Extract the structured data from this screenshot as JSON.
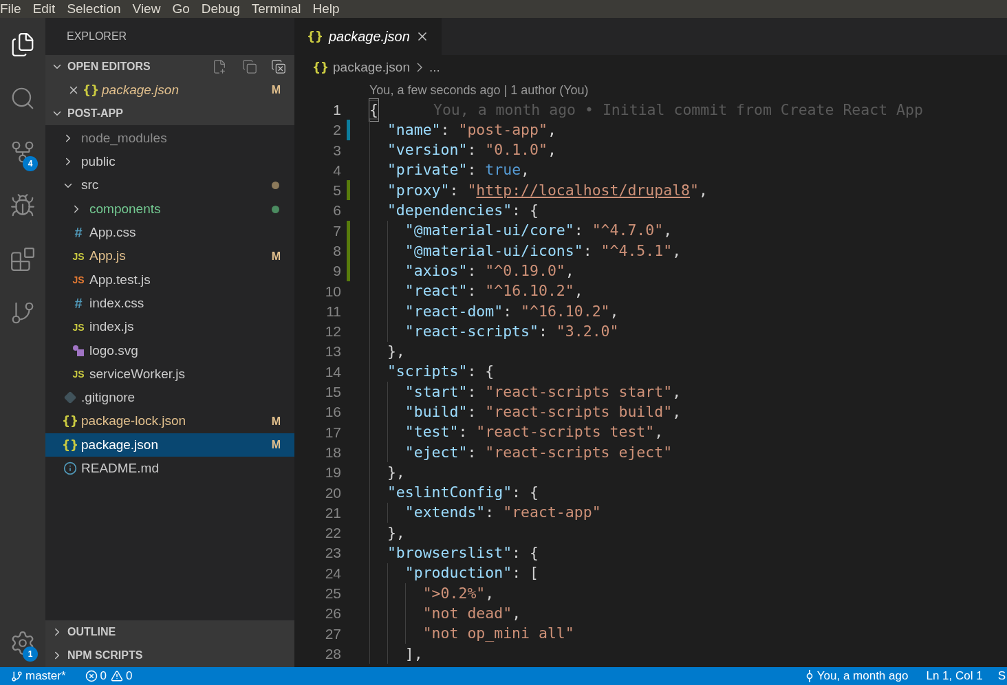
{
  "menu": [
    "File",
    "Edit",
    "Selection",
    "View",
    "Go",
    "Debug",
    "Terminal",
    "Help"
  ],
  "activity_bar": [
    {
      "kind": "files",
      "selected": true
    },
    {
      "kind": "search",
      "selected": false
    },
    {
      "kind": "source-control",
      "selected": false,
      "badge": "4"
    },
    {
      "kind": "debug",
      "selected": false
    },
    {
      "kind": "extensions",
      "selected": false
    },
    {
      "kind": "git-graph",
      "selected": false
    }
  ],
  "settings_badge": "1",
  "sidebar": {
    "title": "EXPLORER",
    "open_editors": {
      "title": "OPEN EDITORS",
      "expanded": true,
      "items": [
        {
          "name": "package.json",
          "kind": "json",
          "glyph": "{}",
          "italic": true,
          "color": "#e2c08d",
          "badge": {
            "text": "M",
            "color": "#e2c08d"
          }
        }
      ]
    },
    "folder": {
      "title": "POST-APP",
      "expanded": true,
      "items": [
        {
          "name": "node_modules",
          "kind": "folder",
          "expanded": false,
          "color": "#8c8c8c",
          "selected": false
        },
        {
          "name": "public",
          "kind": "folder",
          "expanded": false,
          "color": "#cccccc",
          "selected": false
        },
        {
          "name": "src",
          "kind": "folder",
          "expanded": true,
          "color": "#cccccc",
          "selected": false,
          "dot": {
            "color": "#8c7a5b"
          },
          "children": [
            {
              "name": "components",
              "kind": "folder",
              "expanded": false,
              "color": "#73c991",
              "selected": false,
              "dot": {
                "color": "#4b8b60"
              }
            },
            {
              "name": "App.css",
              "kind": "css",
              "glyph": "#",
              "color": "#cccccc",
              "selected": false
            },
            {
              "name": "App.js",
              "kind": "js",
              "glyph": "JS",
              "color": "#e2c08d",
              "selected": false,
              "badge": {
                "text": "M",
                "color": "#e2c08d"
              }
            },
            {
              "name": "App.test.js",
              "kind": "js-test",
              "glyph": "JS",
              "color": "#cccccc",
              "selected": false
            },
            {
              "name": "index.css",
              "kind": "css",
              "glyph": "#",
              "color": "#cccccc",
              "selected": false
            },
            {
              "name": "index.js",
              "kind": "js",
              "glyph": "JS",
              "color": "#cccccc",
              "selected": false
            },
            {
              "name": "logo.svg",
              "kind": "svg",
              "color": "#cccccc",
              "selected": false
            },
            {
              "name": "serviceWorker.js",
              "kind": "js",
              "glyph": "JS",
              "color": "#cccccc",
              "selected": false
            }
          ]
        },
        {
          "name": ".gitignore",
          "kind": "git",
          "color": "#cccccc",
          "selected": false
        },
        {
          "name": "package-lock.json",
          "kind": "json",
          "glyph": "{}",
          "color": "#e2c08d",
          "selected": false,
          "badge": {
            "text": "M",
            "color": "#e2c08d"
          }
        },
        {
          "name": "package.json",
          "kind": "json",
          "glyph": "{}",
          "color": "#ffffff",
          "selected": true,
          "badge": {
            "text": "M",
            "color": "#e2c08d"
          }
        },
        {
          "name": "README.md",
          "kind": "info",
          "color": "#cccccc",
          "selected": false
        }
      ]
    },
    "bottom_sections": [
      {
        "title": "OUTLINE",
        "expanded": false
      },
      {
        "title": "NPM SCRIPTS",
        "expanded": false
      }
    ]
  },
  "editor": {
    "tabs": [
      {
        "label": "package.json",
        "kind": "json",
        "glyph": "{}",
        "italic": true,
        "selected": true
      }
    ],
    "breadcrumb": [
      {
        "glyph": "{}",
        "label": "package.json"
      },
      {
        "label": "..."
      }
    ],
    "blame_header": "You, a few seconds ago | 1 author (You)",
    "lines": [
      {
        "number": "1",
        "text": "{",
        "current": true,
        "cursor": true,
        "blame": "You, a month ago • Initial commit from Create React App",
        "children": [
          {
            "number": "2",
            "text": "\"name\": \"post-app\",",
            "current": false,
            "marker": {
              "color": "#0c7d9d"
            }
          },
          {
            "number": "3",
            "text": "\"version\": \"0.1.0\",",
            "current": false
          },
          {
            "number": "4",
            "text": "\"private\": true,",
            "current": false
          },
          {
            "number": "5",
            "text": "\"proxy\": \"http://localhost/drupal8\",",
            "current": false,
            "marker": {
              "color": "#587c0c"
            }
          },
          {
            "number": "6",
            "text": "\"dependencies\": {",
            "current": false,
            "children": [
              {
                "number": "7",
                "text": "\"@material-ui/core\": \"^4.7.0\",",
                "current": false,
                "marker": {
                  "color": "#587c0c"
                }
              },
              {
                "number": "8",
                "text": "\"@material-ui/icons\": \"^4.5.1\",",
                "current": false,
                "marker": {
                  "color": "#587c0c"
                }
              },
              {
                "number": "9",
                "text": "\"axios\": \"^0.19.0\",",
                "current": false,
                "marker": {
                  "color": "#587c0c"
                }
              },
              {
                "number": "10",
                "text": "\"react\": \"^16.10.2\",",
                "current": false
              },
              {
                "number": "11",
                "text": "\"react-dom\": \"^16.10.2\",",
                "current": false
              },
              {
                "number": "12",
                "text": "\"react-scripts\": \"3.2.0\"",
                "current": false
              }
            ]
          },
          {
            "number": "13",
            "text": "},",
            "current": false
          },
          {
            "number": "14",
            "text": "\"scripts\": {",
            "current": false,
            "children": [
              {
                "number": "15",
                "text": "\"start\": \"react-scripts start\",",
                "current": false
              },
              {
                "number": "16",
                "text": "\"build\": \"react-scripts build\",",
                "current": false
              },
              {
                "number": "17",
                "text": "\"test\": \"react-scripts test\",",
                "current": false
              },
              {
                "number": "18",
                "text": "\"eject\": \"react-scripts eject\"",
                "current": false
              }
            ]
          },
          {
            "number": "19",
            "text": "},",
            "current": false
          },
          {
            "number": "20",
            "text": "\"eslintConfig\": {",
            "current": false,
            "children": [
              {
                "number": "21",
                "text": "\"extends\": \"react-app\"",
                "current": false
              }
            ]
          },
          {
            "number": "22",
            "text": "},",
            "current": false
          },
          {
            "number": "23",
            "text": "\"browserslist\": {",
            "current": false,
            "children": [
              {
                "number": "24",
                "text": "\"production\": [",
                "current": false,
                "children": [
                  {
                    "number": "25",
                    "text": "\">0.2%\",",
                    "current": false
                  },
                  {
                    "number": "26",
                    "text": "\"not dead\",",
                    "current": false
                  },
                  {
                    "number": "27",
                    "text": "\"not op_mini all\"",
                    "current": false
                  }
                ]
              },
              {
                "number": "28",
                "text": "],",
                "current": false
              }
            ]
          }
        ]
      }
    ]
  },
  "status_bar": {
    "branch": "master*",
    "errors": "0",
    "warnings": "0",
    "blame": "You, a month ago",
    "position": "Ln 1, Col 1",
    "item_cut": "S"
  }
}
